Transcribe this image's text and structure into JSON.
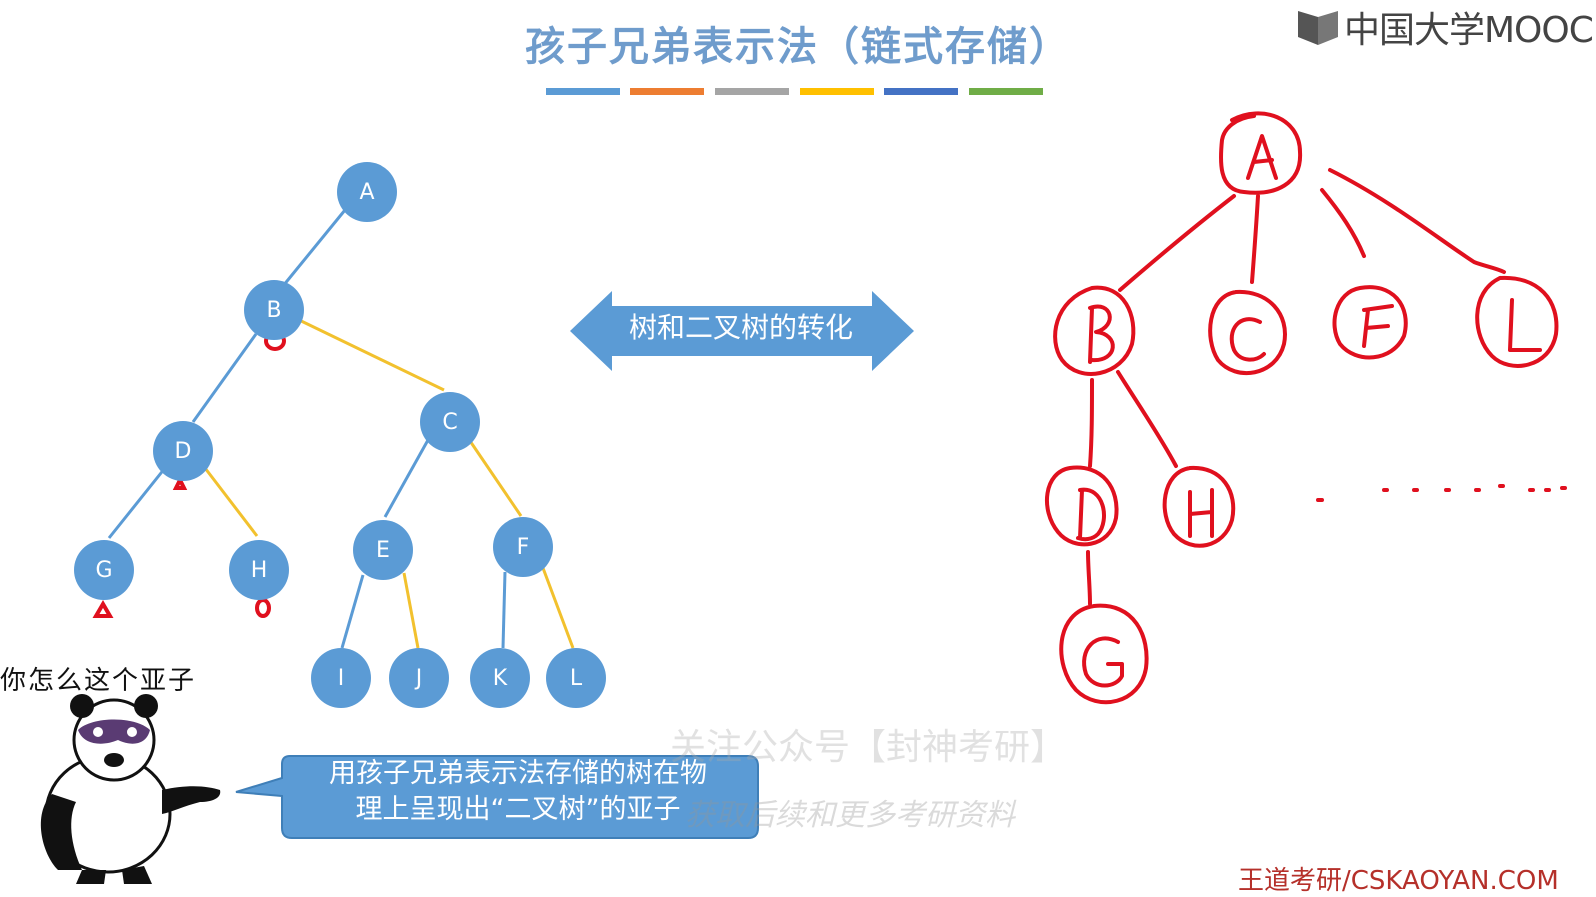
{
  "title": "孩子兄弟表示法（链式存储）",
  "colors": {
    "title": "#6f9ccc",
    "node_fill": "#5b9bd5",
    "edge_child": "#5b9bd5",
    "edge_sibling": "#f2c12e",
    "ink_red": "#e0101e",
    "arrow_fill": "#5b9bd5",
    "callout_fill": "#5b9bd5",
    "title_bars": [
      "#5b9bd5",
      "#ed7d31",
      "#a5a5a5",
      "#ffc000",
      "#4472c4",
      "#70ad47"
    ]
  },
  "logo": {
    "text": "中国大学MOOC",
    "icon": "mooc-book-icon"
  },
  "arrow": {
    "label": "树和二叉树的转化",
    "icon": "double-arrow-icon"
  },
  "binary_tree": {
    "nodes": [
      "A",
      "B",
      "C",
      "D",
      "E",
      "F",
      "G",
      "H",
      "I",
      "J",
      "K",
      "L"
    ]
  },
  "handwritten_tree": {
    "nodes": [
      "A",
      "B",
      "C",
      "F",
      "L",
      "D",
      "H",
      "G"
    ]
  },
  "callout": {
    "line1": "用孩子兄弟表示法存储的树在物",
    "line2": "理上呈现出“二叉树”的亚子"
  },
  "panda": {
    "caption": "你怎么这个亚子",
    "icon": "panda-meme-icon"
  },
  "watermark": {
    "line1": "关注公众号【封神考研】",
    "line2": "获取后续和更多考研资料"
  },
  "footer": {
    "site": "王道考研/CSKAOYAN.COM"
  }
}
